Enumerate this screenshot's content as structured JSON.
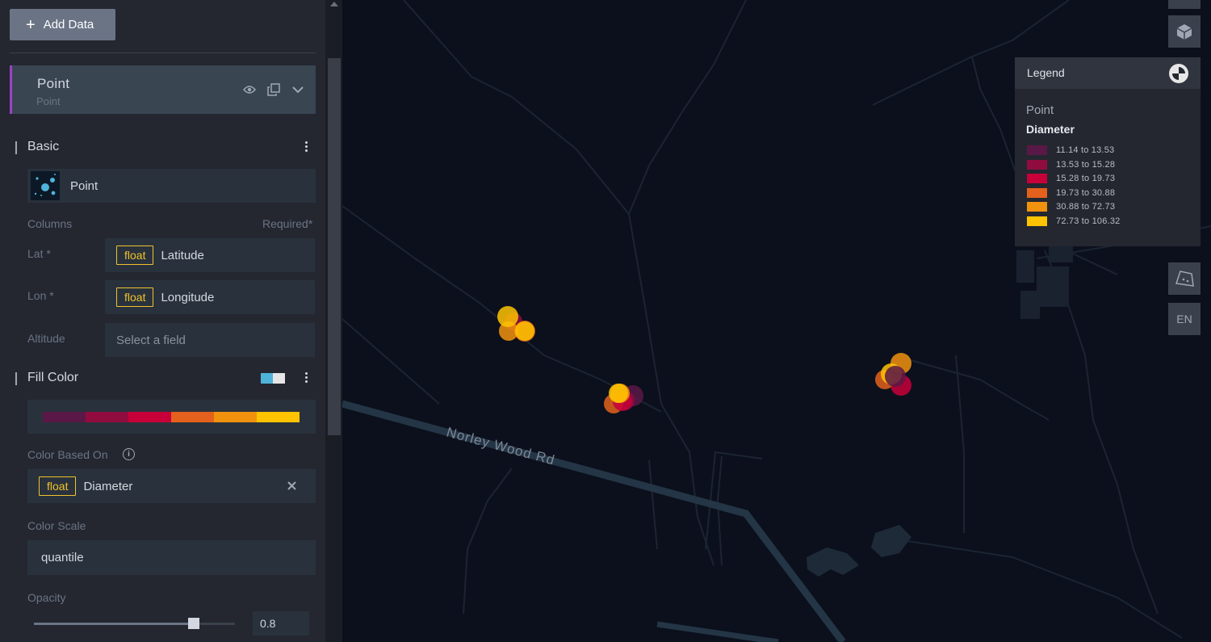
{
  "sidebar": {
    "add_data_label": "Add Data",
    "layer": {
      "title": "Point",
      "subtitle": "Point"
    },
    "basic": {
      "title": "Basic",
      "layer_type": "Point",
      "columns_label": "Columns",
      "required_label": "Required*",
      "fields": [
        {
          "label": "Lat *",
          "tag": "float",
          "value": "Latitude"
        },
        {
          "label": "Lon *",
          "tag": "float",
          "value": "Longitude"
        },
        {
          "label": "Altitude",
          "placeholder": "Select a field"
        }
      ]
    },
    "fill_color": {
      "title": "Fill Color",
      "enabled": true,
      "palette": [
        "#5A1846",
        "#900C3F",
        "#C70039",
        "#E3611C",
        "#F1920E",
        "#FFC300"
      ],
      "based_on_label": "Color Based On",
      "based_on_tag": "float",
      "based_on_value": "Diameter",
      "scale_label": "Color Scale",
      "scale_value": "quantile",
      "opacity_label": "Opacity",
      "opacity_value": "0.8"
    }
  },
  "legend": {
    "header": "Legend",
    "layer": "Point",
    "field": "Diameter",
    "items": [
      {
        "color": "#5A1846",
        "range": "11.14 to 13.53"
      },
      {
        "color": "#900C3F",
        "range": "13.53 to 15.28"
      },
      {
        "color": "#C70039",
        "range": "15.28 to 19.73"
      },
      {
        "color": "#E3611C",
        "range": "19.73 to 30.88"
      },
      {
        "color": "#F1920E",
        "range": "30.88 to 72.73"
      },
      {
        "color": "#FFC300",
        "range": "72.73 to 106.32"
      }
    ]
  },
  "map": {
    "road_label": "Norley Wood Rd",
    "language": "EN"
  }
}
